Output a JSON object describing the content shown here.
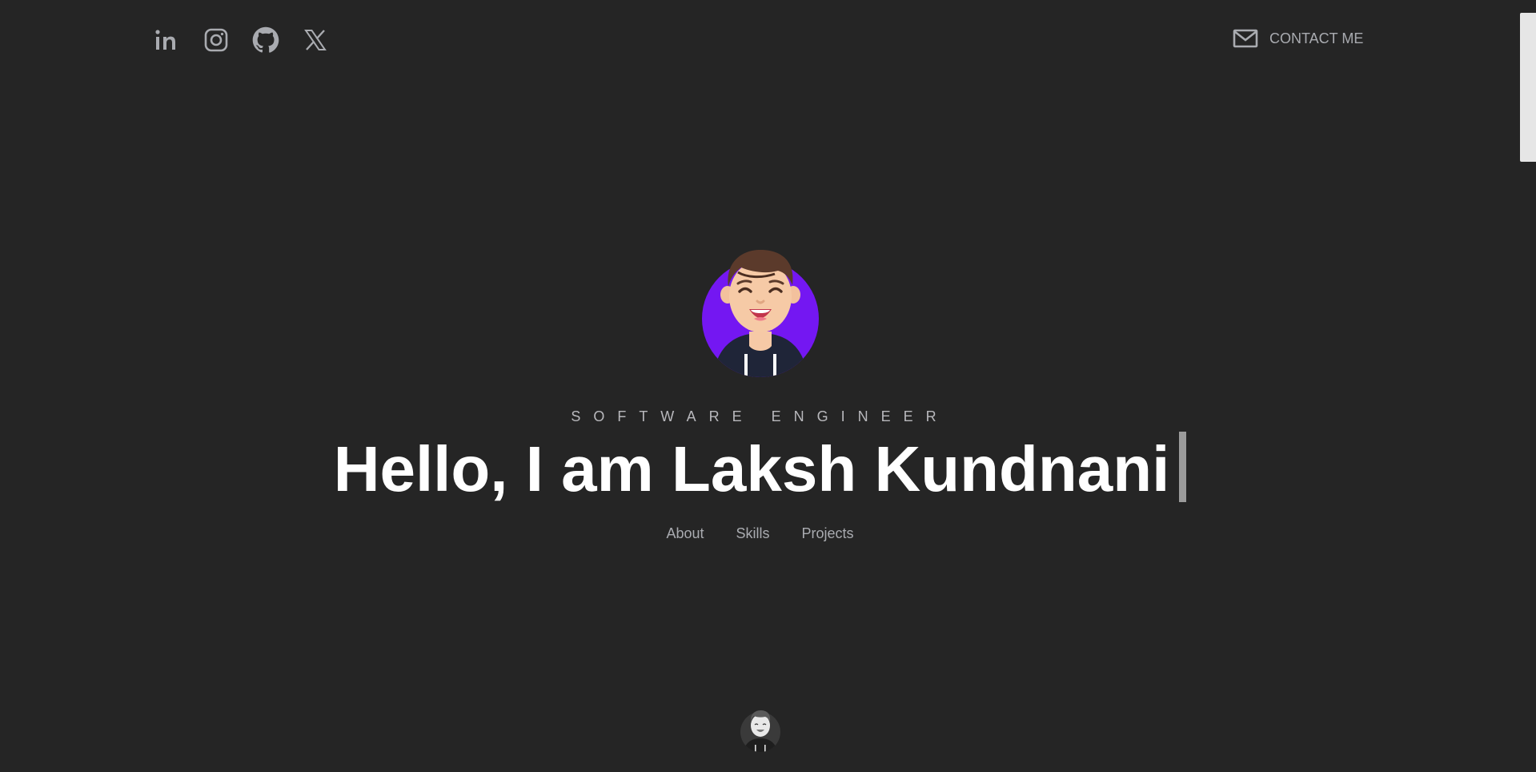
{
  "social": {
    "items": [
      {
        "icon": "linkedin-icon",
        "label": "LinkedIn"
      },
      {
        "icon": "instagram-icon",
        "label": "Instagram"
      },
      {
        "icon": "github-icon",
        "label": "GitHub"
      },
      {
        "icon": "x-icon",
        "label": "X"
      }
    ]
  },
  "header": {
    "contact_label": "CONTACT ME",
    "contact_icon": "mail-icon"
  },
  "hero": {
    "role": "SOFTWARE ENGINEER",
    "headline": "Hello, I am Laksh Kundnani",
    "nav": [
      "About",
      "Skills",
      "Projects"
    ]
  },
  "colors": {
    "background": "#252525",
    "muted_text": "#a9abb0",
    "headline": "#ffffff",
    "avatar_circle": "#7417f2"
  }
}
